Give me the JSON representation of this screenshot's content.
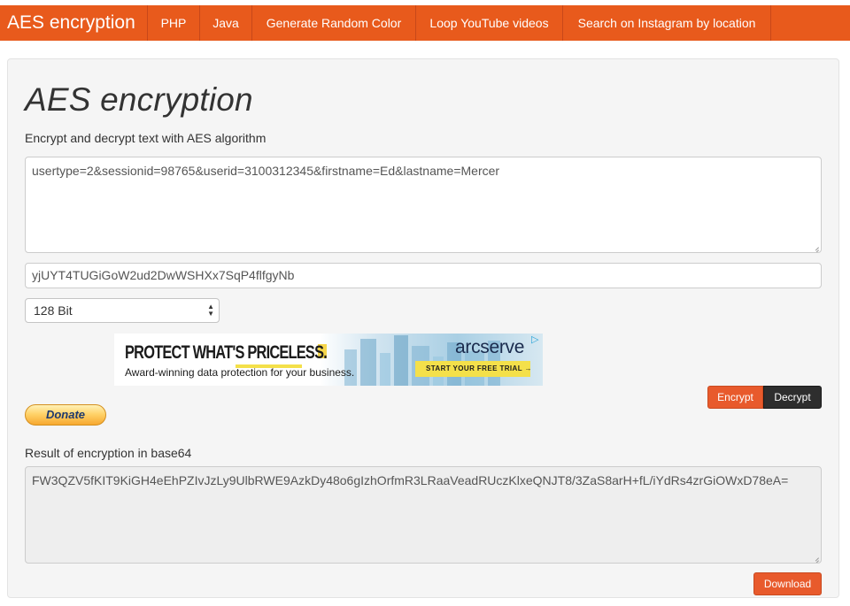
{
  "navbar": {
    "brand": "AES encryption",
    "links": [
      "PHP",
      "Java",
      "Generate Random Color",
      "Loop YouTube videos",
      "Search on Instagram by location"
    ]
  },
  "main": {
    "title": "AES encryption",
    "subtitle": "Encrypt and decrypt text with AES algorithm",
    "plaintext": "usertype=2&sessionid=98765&userid=3100312345&firstname=Ed&lastname=Mercer",
    "key": "yjUYT4TUGiGoW2ud2DwWSHXx7SqP4flfgyNb",
    "key_size": "128 Bit",
    "encrypt_label": "Encrypt",
    "decrypt_label": "Decrypt",
    "donate_label": "Donate",
    "result_label": "Result of encryption in base64",
    "result_value": "FW3QZV5fKIT9KiGH4eEhPZIvJzLy9UlbRWE9AzkDy48o6gIzhOrfmR3LRaaVeadRUczKlxeQNJT8/3ZaS8arH+fL/iYdRs4zrGiOWxD78eA=",
    "download_label": "Download"
  },
  "ad": {
    "headline": "PROTECT WHAT'S PRICELESS.",
    "subtext": "Award-winning data protection for your business.",
    "brand": "arcserve",
    "cta": "START YOUR FREE TRIAL  →"
  },
  "colors": {
    "accent": "#e85a1c",
    "panel": "#f5f5f5",
    "decrypt": "#2e2e2e",
    "ad_yellow": "#f4e04a"
  }
}
